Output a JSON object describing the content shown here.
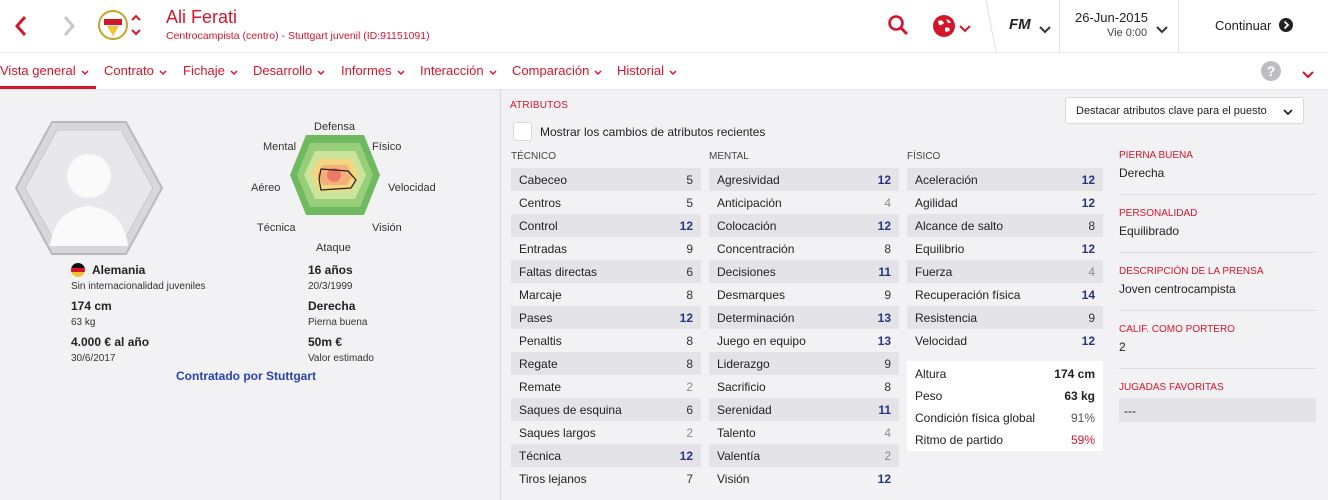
{
  "header": {
    "player_name": "Ali Ferati",
    "player_subtitle": "Centrocampista (centro) - Stuttgart juvenil (ID:91151091)",
    "brand": "FM",
    "date": "26-Jun-2015",
    "day": "Vie 0:00",
    "continue_label": "Continuar"
  },
  "nav": {
    "tabs": [
      "Vista general",
      "Contrato",
      "Fichaje",
      "Desarrollo",
      "Informes",
      "Interacción",
      "Comparación",
      "Historial"
    ],
    "help": "?"
  },
  "radar": {
    "labels": [
      "Defensa",
      "Físico",
      "Velocidad",
      "Visión",
      "Ataque",
      "Técnica",
      "Aéreo",
      "Mental"
    ]
  },
  "profile": {
    "nationality": "Alemania",
    "caps": "Sin internacionalidad juveniles",
    "height": "174 cm",
    "weight": "63 kg",
    "wage": "4.000 € al año",
    "contract_end": "30/6/2017",
    "age": "16 años",
    "birth_date": "20/3/1999",
    "foot": "Derecha",
    "foot_label": "Pierna buena",
    "value": "50m €",
    "value_label": "Valor estimado",
    "signed_by": "Contratado por Stuttgart"
  },
  "attributes": {
    "section_title": "ATRIBUTOS",
    "highlight_select": "Destacar atributos clave para el puesto",
    "show_changes_label": "Mostrar los cambios de atributos recientes",
    "technical_title": "TÉCNICO",
    "mental_title": "MENTAL",
    "physical_title": "FÍSICO",
    "technical": [
      {
        "name": "Cabeceo",
        "value": "5"
      },
      {
        "name": "Centros",
        "value": "5"
      },
      {
        "name": "Control",
        "value": "12"
      },
      {
        "name": "Entradas",
        "value": "9"
      },
      {
        "name": "Faltas directas",
        "value": "6"
      },
      {
        "name": "Marcaje",
        "value": "8"
      },
      {
        "name": "Pases",
        "value": "12"
      },
      {
        "name": "Penaltis",
        "value": "8"
      },
      {
        "name": "Regate",
        "value": "8"
      },
      {
        "name": "Remate",
        "value": "2"
      },
      {
        "name": "Saques de esquina",
        "value": "6"
      },
      {
        "name": "Saques largos",
        "value": "2"
      },
      {
        "name": "Técnica",
        "value": "12"
      },
      {
        "name": "Tiros lejanos",
        "value": "7"
      }
    ],
    "mental": [
      {
        "name": "Agresividad",
        "value": "12"
      },
      {
        "name": "Anticipación",
        "value": "4"
      },
      {
        "name": "Colocación",
        "value": "12"
      },
      {
        "name": "Concentración",
        "value": "8"
      },
      {
        "name": "Decisiones",
        "value": "11"
      },
      {
        "name": "Desmarques",
        "value": "9"
      },
      {
        "name": "Determinación",
        "value": "13"
      },
      {
        "name": "Juego en equipo",
        "value": "13"
      },
      {
        "name": "Liderazgo",
        "value": "9"
      },
      {
        "name": "Sacrificio",
        "value": "8"
      },
      {
        "name": "Serenidad",
        "value": "11"
      },
      {
        "name": "Talento",
        "value": "4"
      },
      {
        "name": "Valentía",
        "value": "2"
      },
      {
        "name": "Visión",
        "value": "12"
      }
    ],
    "physical": [
      {
        "name": "Aceleración",
        "value": "12"
      },
      {
        "name": "Agilidad",
        "value": "12"
      },
      {
        "name": "Alcance de salto",
        "value": "8"
      },
      {
        "name": "Equilibrio",
        "value": "12"
      },
      {
        "name": "Fuerza",
        "value": "4"
      },
      {
        "name": "Recuperación física",
        "value": "14"
      },
      {
        "name": "Resistencia",
        "value": "9"
      },
      {
        "name": "Velocidad",
        "value": "12"
      }
    ],
    "physical_stats": [
      {
        "name": "Altura",
        "value": "174 cm"
      },
      {
        "name": "Peso",
        "value": "63 kg"
      },
      {
        "name": "Condición física global",
        "value": "91%"
      },
      {
        "name": "Ritmo de partido",
        "value": "59%"
      }
    ]
  },
  "side_info": [
    {
      "label": "PIERNA BUENA",
      "value": "Derecha"
    },
    {
      "label": "PERSONALIDAD",
      "value": "Equilibrado"
    },
    {
      "label": "DESCRIPCIÓN DE LA PRENSA",
      "value": "Joven centrocampista"
    },
    {
      "label": "CALIF. COMO PORTERO",
      "value": "2"
    },
    {
      "label": "JUGADAS FAVORITAS",
      "value": "---"
    }
  ],
  "colors": {
    "accent": "#d4162c",
    "high_value": "#2a3580",
    "low_value": "#8a8a8a",
    "match_rhythm": "#d4162c",
    "link": "#2a43b0"
  }
}
